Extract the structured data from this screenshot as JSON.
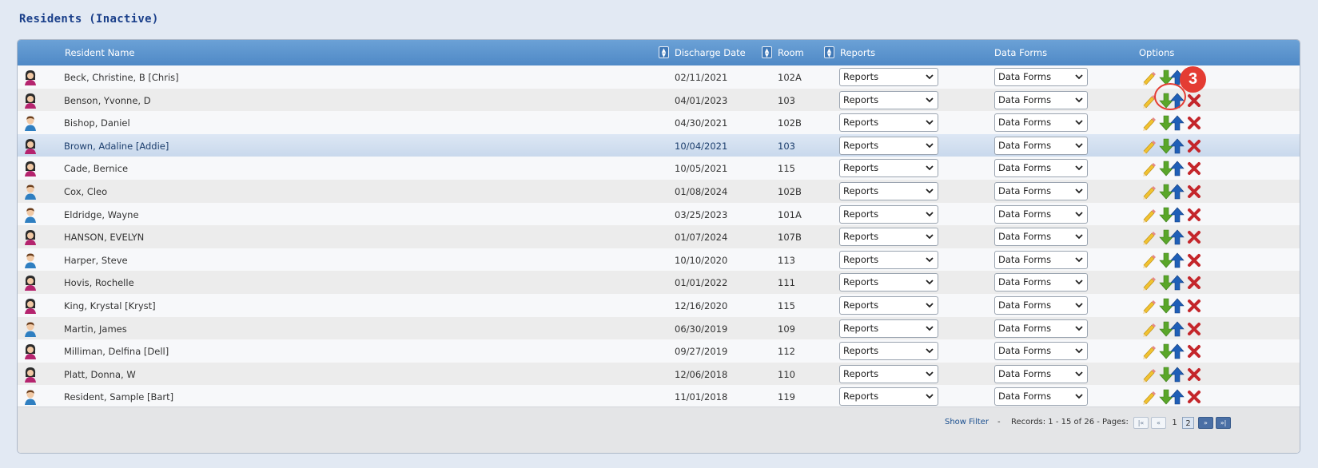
{
  "page": {
    "title": "Residents (Inactive)"
  },
  "grid": {
    "columns": {
      "name": "Resident Name",
      "discharge": "Discharge Date",
      "room": "Room",
      "reports": "Reports",
      "data_forms": "Data Forms",
      "options": "Options"
    },
    "rows": [
      {
        "name": "Beck, Christine, B [Chris]",
        "discharge": "02/11/2021",
        "room": "102A",
        "gender": "female",
        "reports": "Reports",
        "data_forms": "Data Forms"
      },
      {
        "name": "Benson, Yvonne, D",
        "discharge": "04/01/2023",
        "room": "103",
        "gender": "female",
        "reports": "Reports",
        "data_forms": "Data Forms"
      },
      {
        "name": "Bishop, Daniel",
        "discharge": "04/30/2021",
        "room": "102B",
        "gender": "male",
        "reports": "Reports",
        "data_forms": "Data Forms"
      },
      {
        "name": "Brown, Adaline [Addie]",
        "discharge": "10/04/2021",
        "room": "103",
        "gender": "female",
        "reports": "Reports",
        "data_forms": "Data Forms",
        "selected": true
      },
      {
        "name": "Cade, Bernice",
        "discharge": "10/05/2021",
        "room": "115",
        "gender": "female",
        "reports": "Reports",
        "data_forms": "Data Forms"
      },
      {
        "name": "Cox, Cleo",
        "discharge": "01/08/2024",
        "room": "102B",
        "gender": "male",
        "reports": "Reports",
        "data_forms": "Data Forms"
      },
      {
        "name": "Eldridge, Wayne",
        "discharge": "03/25/2023",
        "room": "101A",
        "gender": "male",
        "reports": "Reports",
        "data_forms": "Data Forms"
      },
      {
        "name": "HANSON, EVELYN",
        "discharge": "01/07/2024",
        "room": "107B",
        "gender": "female",
        "reports": "Reports",
        "data_forms": "Data Forms"
      },
      {
        "name": "Harper, Steve",
        "discharge": "10/10/2020",
        "room": "113",
        "gender": "male",
        "reports": "Reports",
        "data_forms": "Data Forms"
      },
      {
        "name": "Hovis, Rochelle",
        "discharge": "01/01/2022",
        "room": "111",
        "gender": "female",
        "reports": "Reports",
        "data_forms": "Data Forms"
      },
      {
        "name": "King, Krystal [Kryst]",
        "discharge": "12/16/2020",
        "room": "115",
        "gender": "female",
        "reports": "Reports",
        "data_forms": "Data Forms"
      },
      {
        "name": "Martin, James",
        "discharge": "06/30/2019",
        "room": "109",
        "gender": "male",
        "reports": "Reports",
        "data_forms": "Data Forms"
      },
      {
        "name": "Milliman, Delfina [Dell]",
        "discharge": "09/27/2019",
        "room": "112",
        "gender": "female",
        "reports": "Reports",
        "data_forms": "Data Forms"
      },
      {
        "name": "Platt, Donna, W",
        "discharge": "12/06/2018",
        "room": "110",
        "gender": "female",
        "reports": "Reports",
        "data_forms": "Data Forms"
      },
      {
        "name": "Resident, Sample [Bart]",
        "discharge": "11/01/2018",
        "room": "119",
        "gender": "male",
        "reports": "Reports",
        "data_forms": "Data Forms"
      }
    ]
  },
  "footer": {
    "show_filter": "Show Filter",
    "separator": "-",
    "records": "Records: 1 - 15 of 26 - Pages:",
    "pages": [
      "1",
      "2"
    ],
    "current_page": "2"
  },
  "annotation": {
    "badge": "3"
  },
  "colors": {
    "header": "#5b95cf",
    "title": "#1a3f8a",
    "female": "#b5246e",
    "male": "#2f7fc1",
    "download": "#5aa62a",
    "upload": "#1f5fb7",
    "delete": "#c4262b",
    "annotation": "#e43c33"
  },
  "icons": {
    "female_avatar": "female-user-icon",
    "male_avatar": "male-user-icon",
    "edit": "pencil-icon",
    "download": "down-arrow-icon",
    "upload": "up-arrow-icon",
    "delete": "delete-x-icon",
    "sort": "sort-icon"
  }
}
